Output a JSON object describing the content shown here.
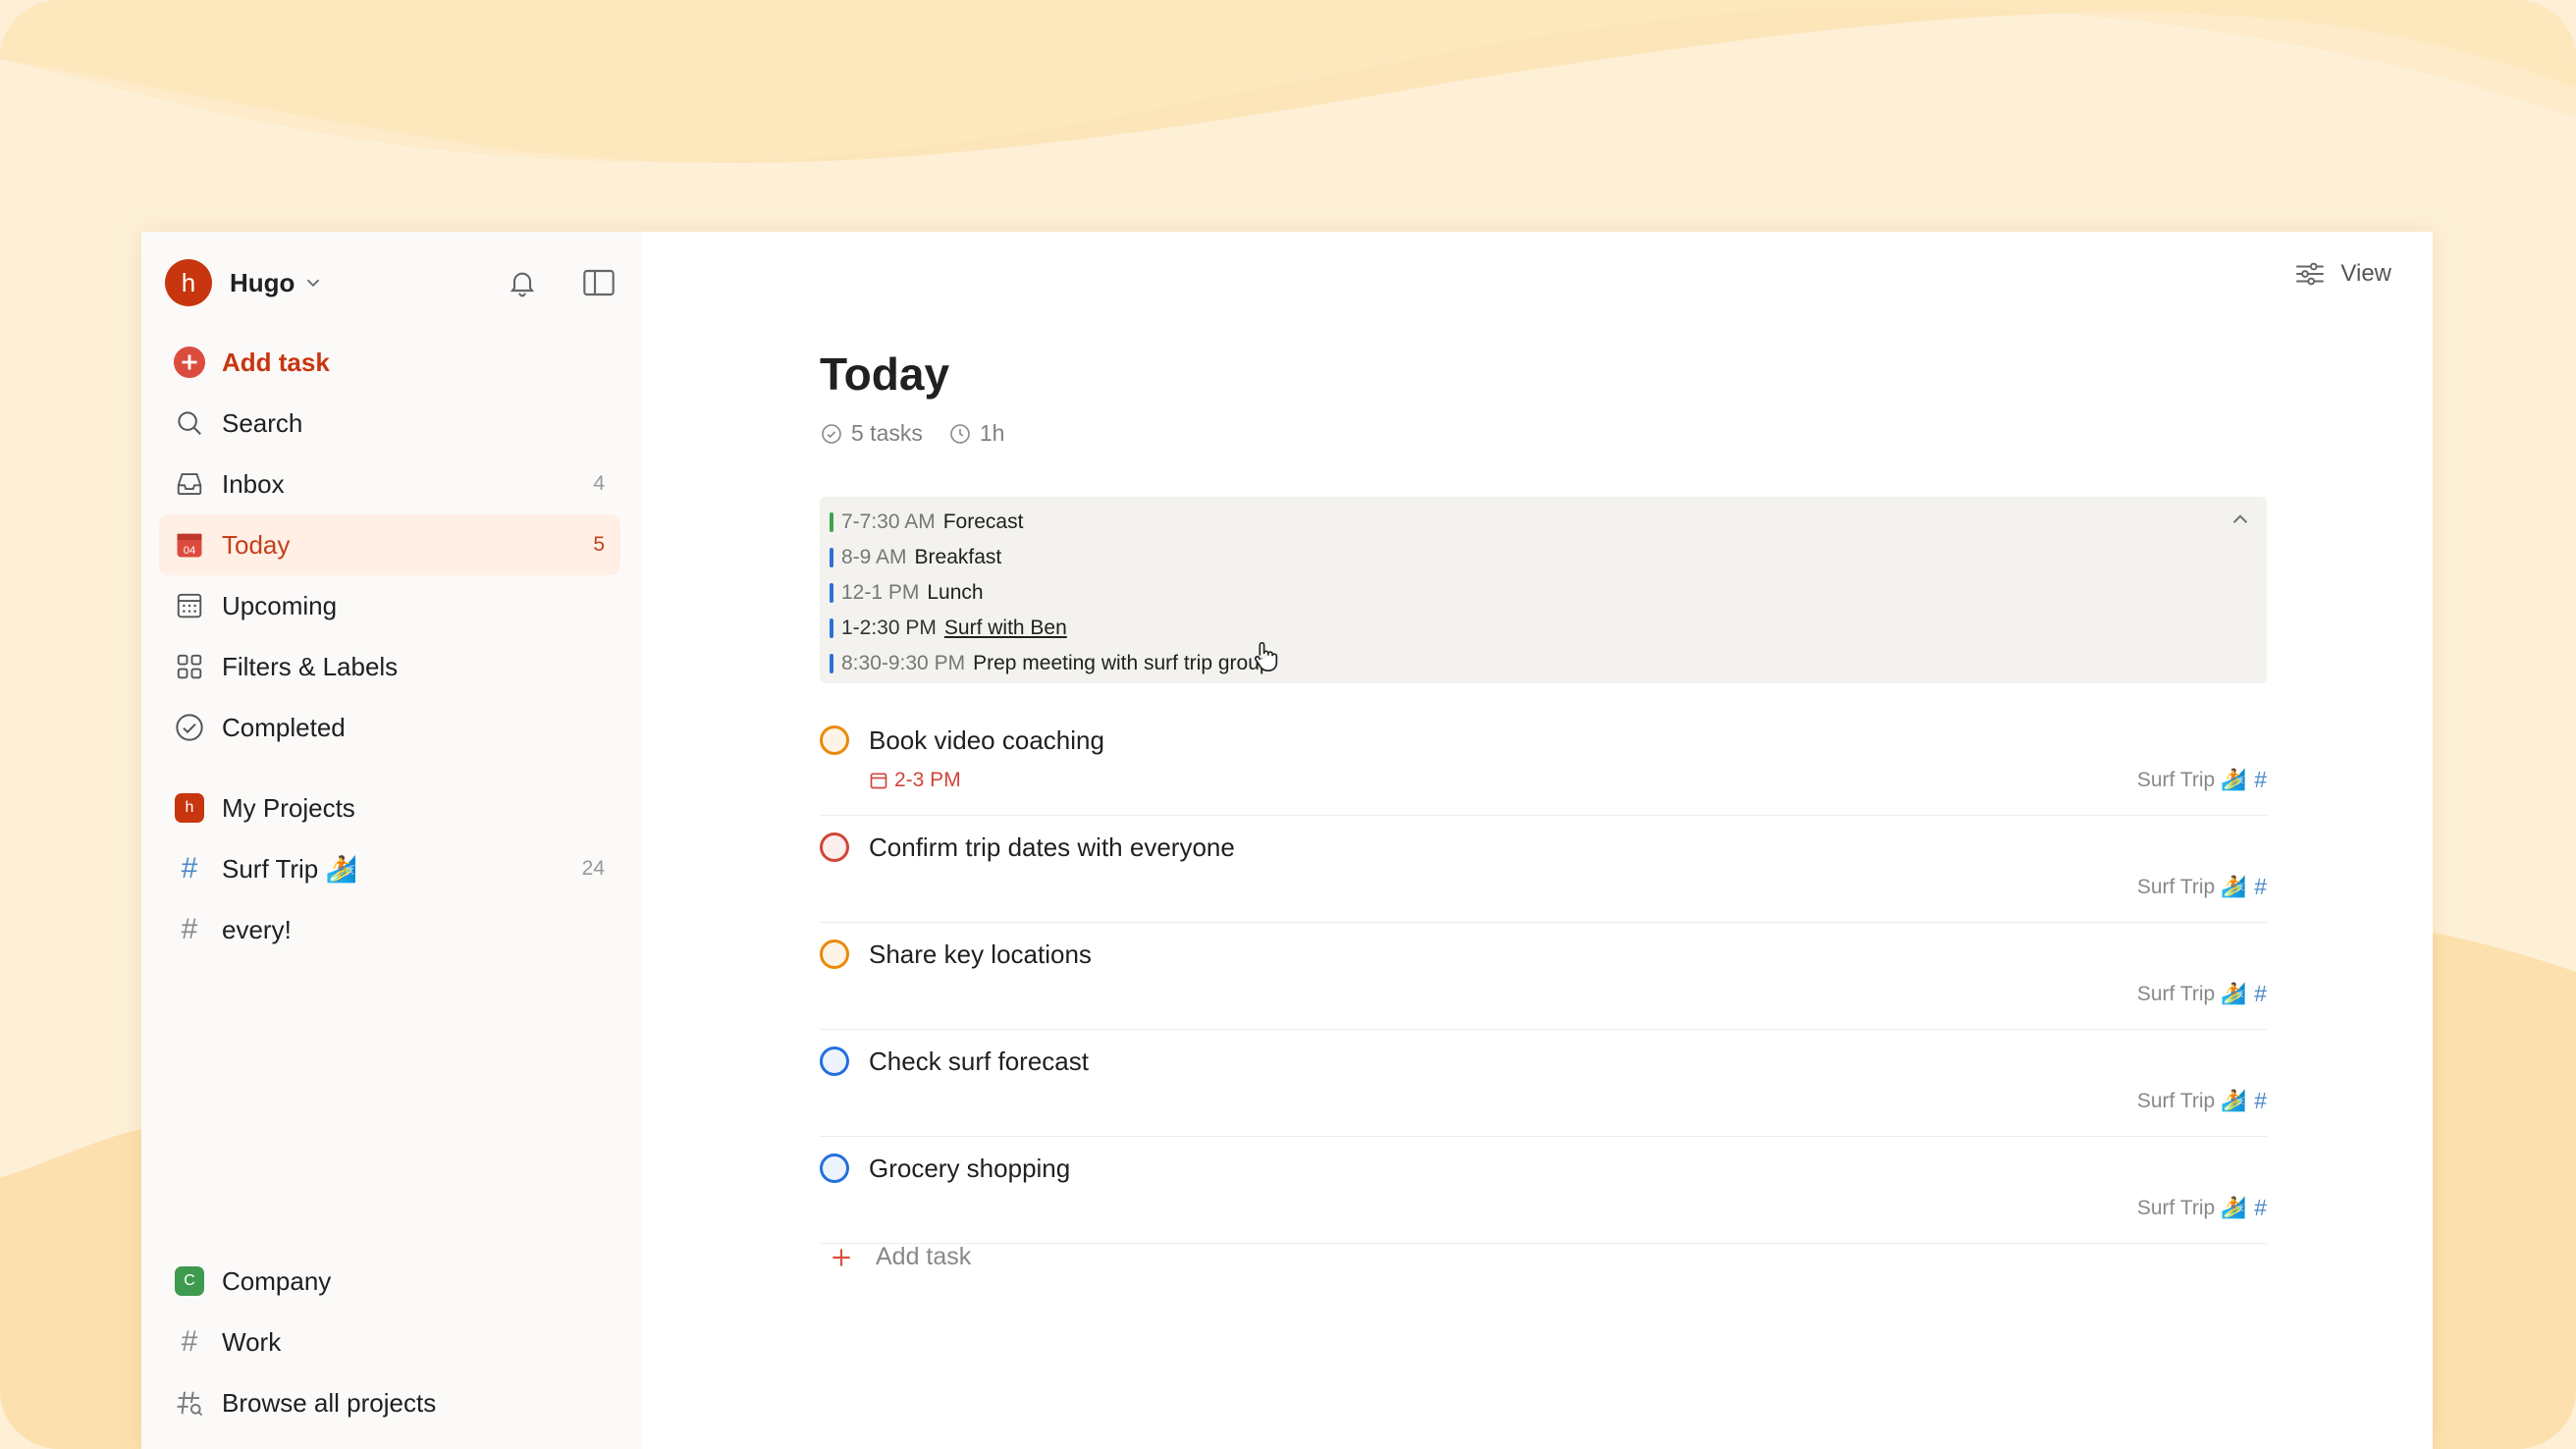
{
  "sidebar": {
    "user": {
      "initial": "h",
      "name": "Hugo"
    },
    "add_task": "Add task",
    "nav": [
      {
        "label": "Search",
        "count": ""
      },
      {
        "label": "Inbox",
        "count": "4"
      },
      {
        "label": "Today",
        "count": "5",
        "date_icon": "04"
      },
      {
        "label": "Upcoming",
        "count": ""
      },
      {
        "label": "Filters & Labels",
        "count": ""
      },
      {
        "label": "Completed",
        "count": ""
      }
    ],
    "my_projects": {
      "initial": "h",
      "label": "My Projects",
      "items": [
        {
          "label": "Surf Trip 🏄",
          "count": "24"
        },
        {
          "label": "every!",
          "count": ""
        }
      ]
    },
    "company": {
      "initial": "C",
      "label": "Company",
      "items": [
        {
          "label": "Work"
        },
        {
          "label": "Browse all projects"
        }
      ]
    }
  },
  "main": {
    "view_label": "View",
    "title": "Today",
    "task_count": "5 tasks",
    "duration": "1h",
    "schedule": [
      {
        "time": "7-7:30 AM",
        "title": "Forecast",
        "color": "#3fa34d"
      },
      {
        "time": "8-9 AM",
        "title": "Breakfast",
        "color": "#2f6fd6"
      },
      {
        "time": "12-1 PM",
        "title": "Lunch",
        "color": "#2f6fd6"
      },
      {
        "time": "1-2:30 PM",
        "title": "Surf with Ben",
        "color": "#2f6fd6"
      },
      {
        "time": "8:30-9:30 PM",
        "title": "Prep meeting with surf trip group",
        "color": "#2f6fd6"
      }
    ],
    "tasks": [
      {
        "title": "Book video coaching",
        "due": "2-3 PM",
        "project": "Surf Trip 🏄",
        "ring": "#eb8909"
      },
      {
        "title": "Confirm trip dates with everyone",
        "due": "",
        "project": "Surf Trip 🏄",
        "ring": "#d1453b"
      },
      {
        "title": "Share key locations",
        "due": "",
        "project": "Surf Trip 🏄",
        "ring": "#eb8909"
      },
      {
        "title": "Check surf forecast",
        "due": "",
        "project": "Surf Trip 🏄",
        "ring": "#246fe0"
      },
      {
        "title": "Grocery shopping",
        "due": "",
        "project": "Surf Trip 🏄",
        "ring": "#246fe0"
      }
    ],
    "add_task": "Add task"
  },
  "colors": {
    "accent": "#dc4c3e",
    "active_bg": "#ffefe5",
    "company": "#3e9a4f"
  }
}
